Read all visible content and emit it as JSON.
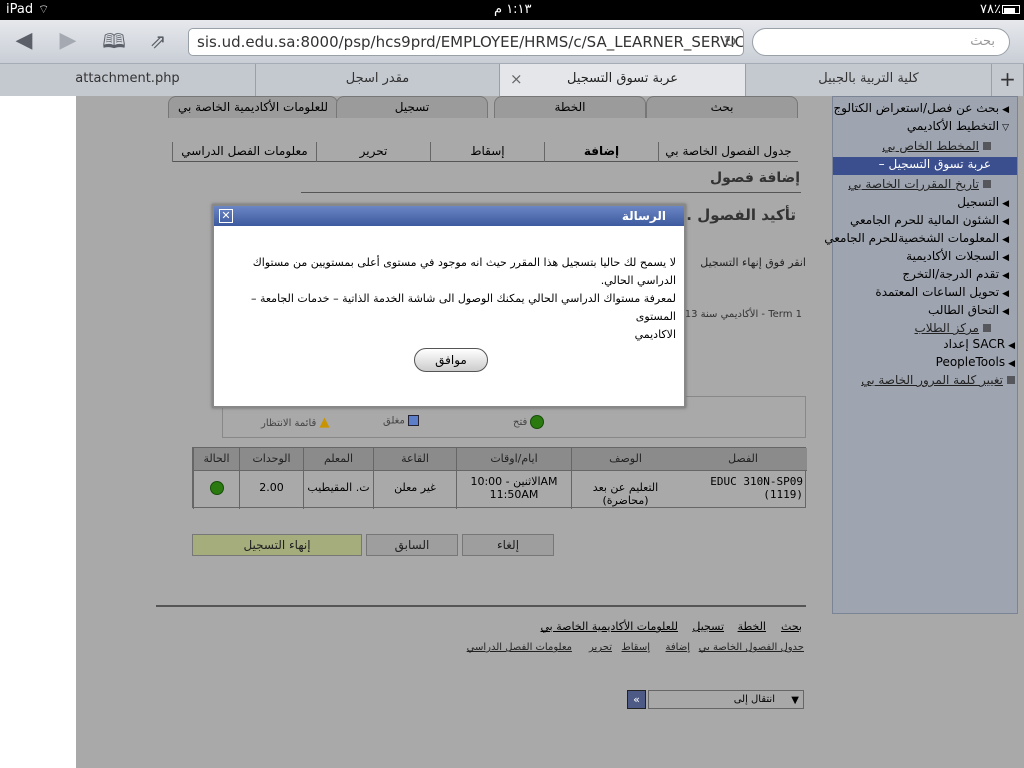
{
  "status_bar": {
    "device": "iPad",
    "time": "١:١٣ م",
    "battery": "٧٨٪"
  },
  "browser": {
    "url": "sis.ud.edu.sa:8000/psp/hcs9prd/EMPLOYEE/HRMS/c/SA_LEARNER_SERVIC",
    "search_placeholder": "بحث",
    "tabs": [
      {
        "label": "attachment.php"
      },
      {
        "label": "مقدر اسجل"
      },
      {
        "label": "عربة تسوق التسجيل"
      },
      {
        "label": "كلية التربية بالجبيل"
      }
    ],
    "new_tab": "+",
    "tab_close": "×"
  },
  "sidebar": {
    "items": [
      {
        "label": "بحث عن فصل/استعراض الكتالوج"
      },
      {
        "label": "التخطيط الأكاديمي"
      },
      {
        "label": "المخطط الخاص بي"
      },
      {
        "label": "– عربة تسوق التسجيل"
      },
      {
        "label": "تاريخ المقررات الخاصة بي"
      },
      {
        "label": "التسجيل"
      },
      {
        "label": "الشئون المالية للحرم الجامعي"
      },
      {
        "label": "المعلومات الشخصيةللحرم الجامعي"
      },
      {
        "label": "السجلات الأكاديمية"
      },
      {
        "label": "تقدم الدرجة/التخرج"
      },
      {
        "label": "تحويل الساعات المعتمدة"
      },
      {
        "label": "التحاق الطالب"
      },
      {
        "label": "مركز الطلاب"
      },
      {
        "label": "إعداد SACR"
      },
      {
        "label": "PeopleTools"
      },
      {
        "label": "تغيير كلمة المرور الخاصة بي"
      }
    ]
  },
  "main": {
    "tabs": [
      "بحث",
      "الخطة",
      "تسجيل",
      "للعلومات الأكاديمية الخاصة بي"
    ],
    "subtabs": [
      "جدول الفصول الخاصة بي",
      "إضافة",
      "إسقاط",
      "تحرير",
      "معلومات الفصل الدراسي"
    ],
    "page_title": "إضافة فصول",
    "step": "2. تأكيد الفصول",
    "instruction": "انقر فوق إنهاء التسجيل",
    "term": "الأكاديمي سنة 2013 - Term 1",
    "legend": {
      "open": "فتح",
      "closed": "مغلق",
      "waitlist": "قائمة الانتظار"
    },
    "table": {
      "headers": [
        "الفصل",
        "الوصف",
        "ايام/اوقات",
        "القاعة",
        "المعلم",
        "الوحدات",
        "الحالة"
      ],
      "row": {
        "class_code": "EDUC 310N-SP09",
        "class_num": "(1119)",
        "description": "التعليم عن بعد (محاضرة)",
        "days_times_1": "الاثنين - 10:00AM",
        "days_times_2": "11:50AM",
        "room": "غير معلن",
        "instructor": "ت. المقيطيب",
        "units": "2.00",
        "status_color": "#2a7a10"
      }
    },
    "buttons": {
      "cancel": "إلغاء",
      "previous": "السابق",
      "finish": "إنهاء التسجيل"
    },
    "bottom_links": [
      "بحث",
      "الخطة",
      "تسجيل",
      "للعلومات الأكاديمية الخاصة بي"
    ],
    "bottom_sublinks": [
      "جدول الفصول الخاصة بي",
      "إضافة",
      "إسقاط",
      "تحرير",
      "معلومات الفصل الدراسي"
    ],
    "jump_to": "انتقال إلى"
  },
  "dialog": {
    "title": "الرسالة",
    "close": "✕",
    "line1": "لا يسمح لك حاليا بتسجيل هذا المقرر حيث انه موجود في مستوى أعلى بمستويين من مستواك",
    "line2": "الدراسي الحالي.",
    "line3": "لمعرفة مستواك الدراسي الحالي يمكنك الوصول الى شاشة الخدمة الذاتية – خدمات الجامعة – المستوى",
    "line4": "الاكاديمي",
    "ok": "موافق"
  }
}
